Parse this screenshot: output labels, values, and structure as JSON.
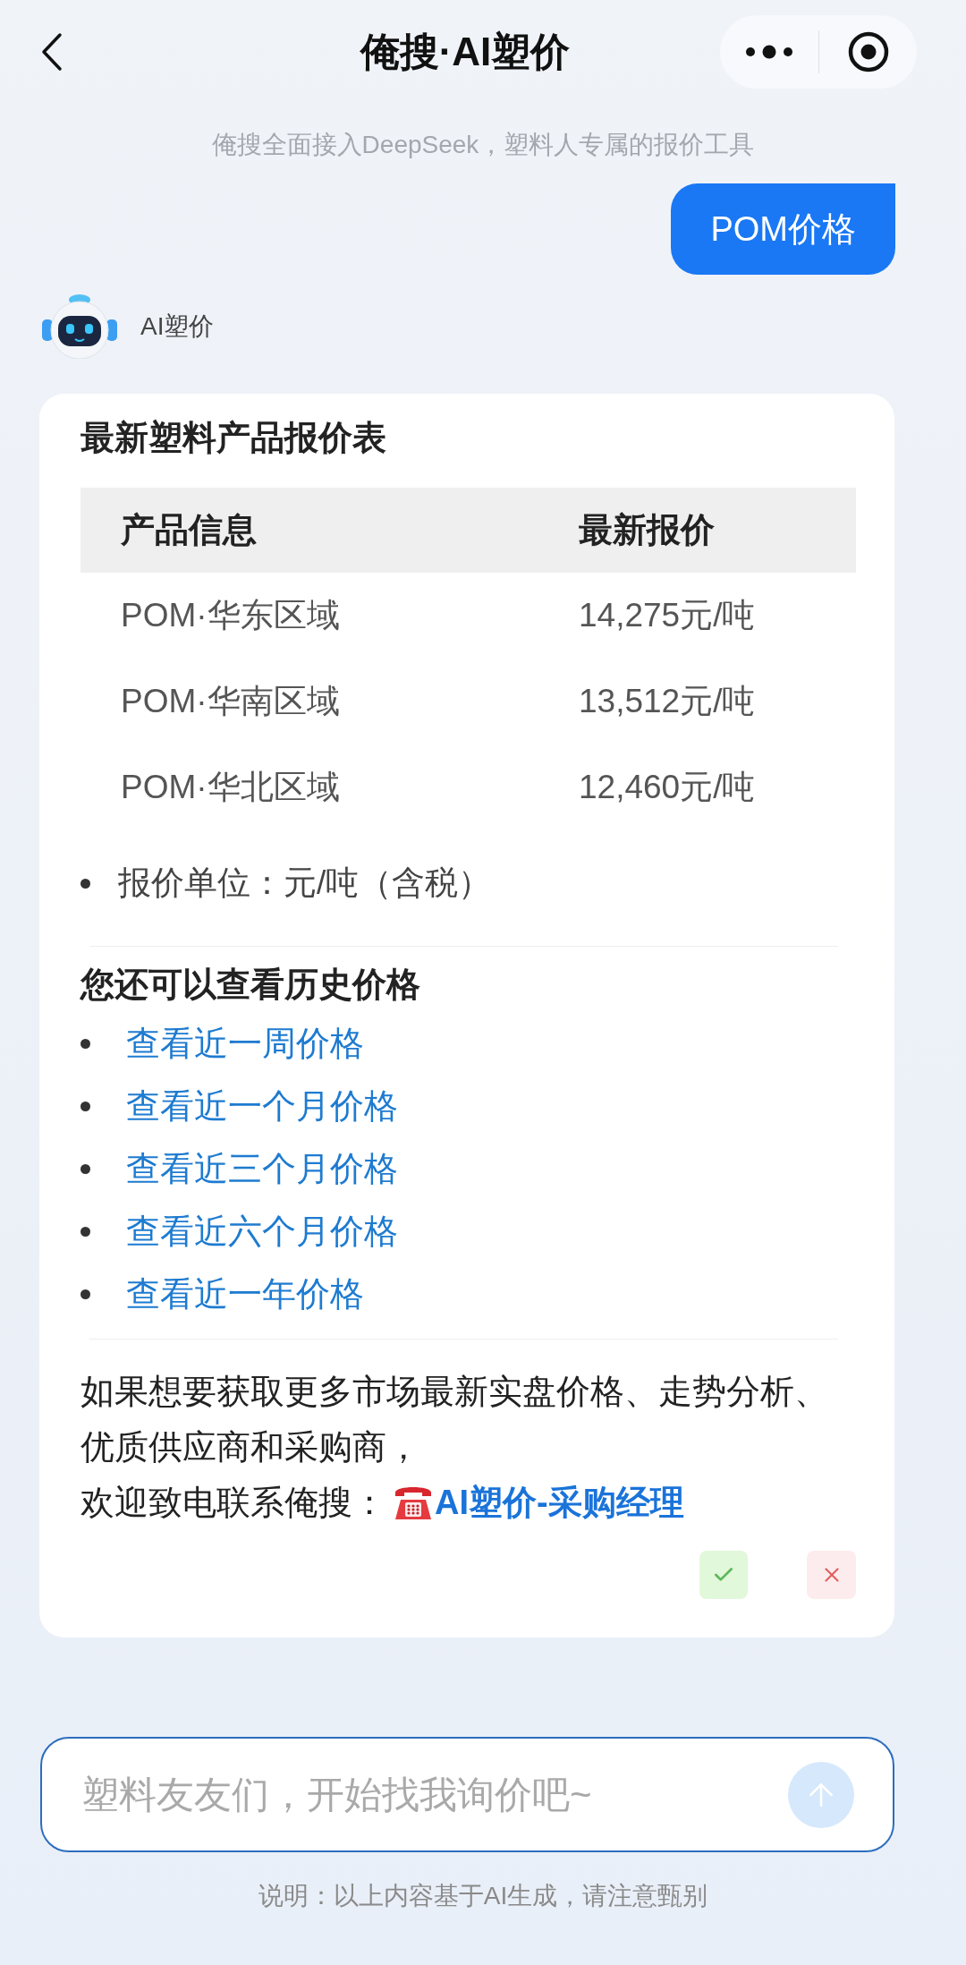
{
  "header": {
    "title": "俺搜·AI塑价"
  },
  "subtitle": "俺搜全面接入DeepSeek，塑料人专属的报价工具",
  "user_message": {
    "text": "POM价格"
  },
  "bot_reply": {
    "sender": "AI塑价",
    "title": "最新塑料产品报价表",
    "table": {
      "columns": [
        "产品信息",
        "最新报价"
      ],
      "rows": [
        [
          "POM·华东区域",
          "14,275元/吨"
        ],
        [
          "POM·华南区域",
          "13,512元/吨"
        ],
        [
          "POM·华北区域",
          "12,460元/吨"
        ]
      ]
    },
    "notes": [
      "报价单位：元/吨（含税）"
    ],
    "history": {
      "heading": "您还可以查看历史价格",
      "links": [
        "查看近一周价格",
        "查看近一个月价格",
        "查看近三个月价格",
        "查看近六个月价格",
        "查看近一年价格"
      ]
    },
    "closing": {
      "text": "如果想要获取更多市场最新实盘价格、走势分析、优质供应商和采购商，",
      "contact_text": "欢迎致电联系俺搜：",
      "contact_link": "AI塑价-采购经理"
    }
  },
  "composer": {
    "placeholder": "塑料友友们，开始找我询价吧~",
    "send_disabled": true
  },
  "disclaimer": "说明：以上内容基于AI生成，请注意甄别"
}
